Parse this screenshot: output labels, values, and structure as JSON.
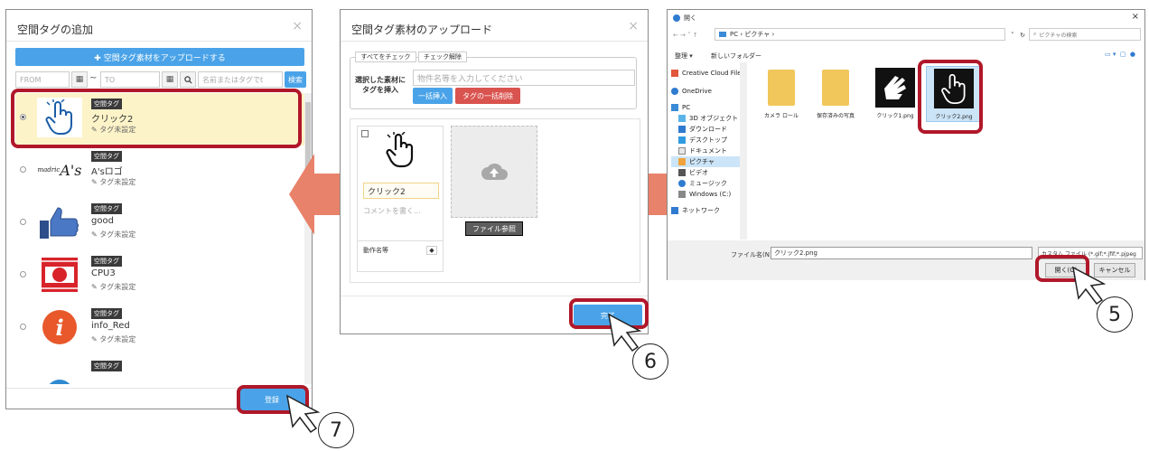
{
  "panel1": {
    "title": "空間タグの追加",
    "close": "×",
    "upload_button": "✚ 空間タグ素材をアップロードする",
    "from_placeholder": "FROM",
    "calendar_icon": "▦",
    "tilde": "~",
    "to_placeholder": "TO",
    "search_icon": "🔍",
    "name_placeholder": "名前またはタグでt",
    "search_button": "検索",
    "items": [
      {
        "badge": "空間タグ",
        "name": "クリック2",
        "tag": "タグ未設定"
      },
      {
        "badge": "空間タグ",
        "name": "A'sロゴ",
        "tag": "タグ未設定"
      },
      {
        "badge": "空間タグ",
        "name": "good",
        "tag": "タグ未設定"
      },
      {
        "badge": "空間タグ",
        "name": "CPU3",
        "tag": "タグ未設定"
      },
      {
        "badge": "空間タグ",
        "name": "info_Red",
        "tag": "タグ未設定"
      },
      {
        "badge": "空間タグ",
        "name": "",
        "tag": ""
      }
    ],
    "register_button": "登録",
    "logo_text": "madric",
    "logo_text2": "A's",
    "info_letter": "i"
  },
  "panel2": {
    "title": "空間タグ素材のアップロード",
    "close": "×",
    "check_all": "すべてをチェック",
    "uncheck": "チェック解除",
    "label_line1": "選択した素材に",
    "label_line2": "タグを挿入",
    "tag_placeholder": "物件名等を入力してください",
    "bulk_insert": "一括挿入",
    "bulk_delete": "タグの一括削除",
    "file_name_value": "クリック2",
    "comment_placeholder": "コメントを書く...",
    "action_name": "動作名等",
    "browse_button": "ファイル参照",
    "done_button": "完了"
  },
  "panel3": {
    "title": "開く",
    "close": "×",
    "address_path": "PC › ピクチャ ›",
    "search_placeholder": "ピクチャの検索",
    "organize": "整理 ▾",
    "new_folder": "新しいフォルダー",
    "nav_items": [
      {
        "label": "Creative Cloud File",
        "icon": "cc-icon"
      },
      {
        "label": "OneDrive",
        "icon": "cloud-icon"
      },
      {
        "label": "PC",
        "icon": "pc-icon"
      },
      {
        "label": "3D オブジェクト",
        "icon": "cube-icon"
      },
      {
        "label": "ダウンロード",
        "icon": "download-icon"
      },
      {
        "label": "デスクトップ",
        "icon": "desktop-icon"
      },
      {
        "label": "ドキュメント",
        "icon": "document-icon"
      },
      {
        "label": "ピクチャ",
        "icon": "picture-icon"
      },
      {
        "label": "ビデオ",
        "icon": "video-icon"
      },
      {
        "label": "ミュージック",
        "icon": "music-icon"
      },
      {
        "label": "Windows (C:)",
        "icon": "drive-icon"
      },
      {
        "label": "ネットワーク",
        "icon": "network-icon"
      }
    ],
    "files": [
      {
        "name": "カメラ ロール",
        "type": "folder"
      },
      {
        "name": "保存済みの写真",
        "type": "folder"
      },
      {
        "name": "クリック1.png",
        "type": "image"
      },
      {
        "name": "クリック2.png",
        "type": "image"
      }
    ],
    "filename_label": "ファイル名(N):",
    "filename_value": "クリック2.png",
    "filetype_value": "カスタム ファイル (*.gif;*.jfif;*.pjpeg",
    "open_button": "開く(O)",
    "cancel_button": "キャンセル"
  },
  "steps": {
    "five": "5",
    "six": "6",
    "seven": "7"
  },
  "colors": {
    "accent_blue": "#4aa3e8",
    "highlight_red": "#b0182a",
    "arrow_orange": "#e8826a",
    "selected_row": "#fdf3c8"
  }
}
